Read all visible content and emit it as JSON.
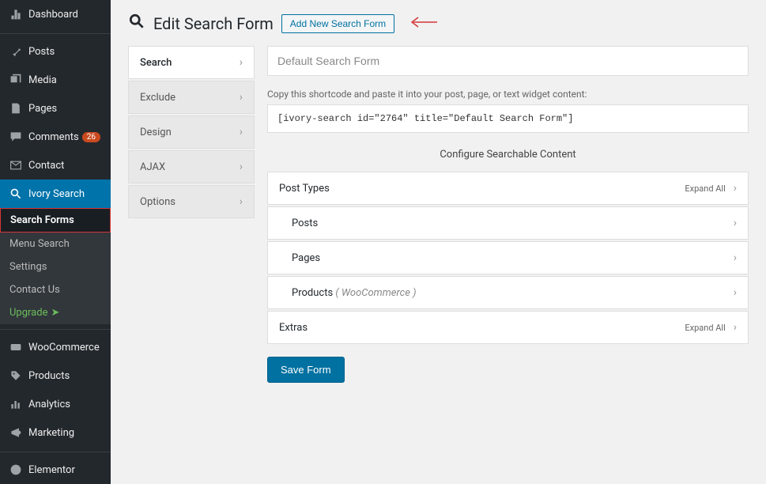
{
  "sidebar": {
    "items": [
      {
        "label": "Dashboard",
        "icon": "dash"
      },
      {
        "label": "Posts",
        "icon": "pin"
      },
      {
        "label": "Media",
        "icon": "media"
      },
      {
        "label": "Pages",
        "icon": "pages"
      },
      {
        "label": "Comments",
        "icon": "comment",
        "badge": "26"
      },
      {
        "label": "Contact",
        "icon": "contact"
      },
      {
        "label": "Ivory Search",
        "icon": "search",
        "active": true
      },
      {
        "label": "WooCommerce",
        "icon": "woo"
      },
      {
        "label": "Products",
        "icon": "product"
      },
      {
        "label": "Analytics",
        "icon": "analytics"
      },
      {
        "label": "Marketing",
        "icon": "marketing"
      },
      {
        "label": "Elementor",
        "icon": "elementor"
      }
    ],
    "submenu": [
      {
        "label": "Search Forms",
        "current": true
      },
      {
        "label": "Menu Search"
      },
      {
        "label": "Settings"
      },
      {
        "label": "Contact Us"
      },
      {
        "label": "Upgrade",
        "upgrade": true,
        "arrow": "➤"
      }
    ]
  },
  "head": {
    "title": "Edit Search Form",
    "add_btn": "Add New Search Form"
  },
  "tabs": [
    {
      "label": "Search",
      "active": true
    },
    {
      "label": "Exclude"
    },
    {
      "label": "Design"
    },
    {
      "label": "AJAX"
    },
    {
      "label": "Options"
    }
  ],
  "form": {
    "title_value": "Default Search Form",
    "helper": "Copy this shortcode and paste it into your post, page, or text widget content:",
    "shortcode": "[ivory-search id=\"2764\" title=\"Default Search Form\"]",
    "section_title": "Configure Searchable Content",
    "expand_all": "Expand All",
    "save": "Save Form"
  },
  "accordion": {
    "post_types": "Post Types",
    "posts": "Posts",
    "pages": "Pages",
    "products": "Products",
    "products_note": "( WooCommerce )",
    "extras": "Extras"
  }
}
